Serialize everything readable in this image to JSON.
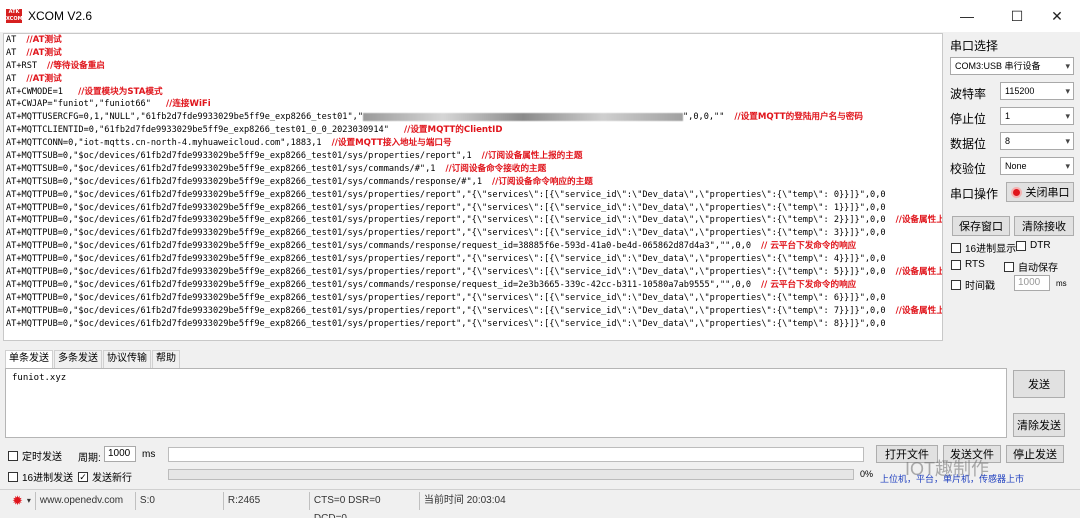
{
  "window": {
    "title": "XCOM V2.6",
    "icon_text": "ATK XCOM",
    "min_glyph": "—",
    "max_glyph": "☐",
    "close_glyph": "✕"
  },
  "receive_lines": [
    {
      "cmd": "AT",
      "comment": "//AT测试"
    },
    {
      "cmd": "AT",
      "comment": "//AT测试"
    },
    {
      "cmd": "AT+RST",
      "comment": "//等待设备重启"
    },
    {
      "cmd": "AT",
      "comment": "//AT测试"
    },
    {
      "cmd": "AT+CWMODE=1 ",
      "comment": "//设置模块为STA模式"
    },
    {
      "cmd": "AT+CWJAP=\"funiot\",\"funiot66\" ",
      "comment": "//连接WiFi"
    },
    {
      "cmd": "AT+MQTTUSERCFG=0,1,\"NULL\",\"61fb2d7fde9933029be5ff9e_exp8266_test01\",\"",
      "redacted": true,
      "cmd2": "\",0,0,\"\"",
      "comment": "//设置MQTT的登陆用户名与密码"
    },
    {
      "cmd": "AT+MQTTCLIENTID=0,\"61fb2d7fde9933029be5ff9e_exp8266_test01_0_0_2023030914\" ",
      "comment": "//设置MQTT的ClientID"
    },
    {
      "cmd": "AT+MQTTCONN=0,\"iot-mqtts.cn-north-4.myhuaweicloud.com\",1883,1",
      "comment": "//设置MQTT接入地址与端口号"
    },
    {
      "cmd": "AT+MQTTSUB=0,\"$oc/devices/61fb2d7fde9933029be5ff9e_exp8266_test01/sys/properties/report\",1",
      "comment": "//订阅设备属性上报的主题"
    },
    {
      "cmd": "AT+MQTTSUB=0,\"$oc/devices/61fb2d7fde9933029be5ff9e_exp8266_test01/sys/commands/#\",1",
      "comment": "//订阅设备命令接收的主题"
    },
    {
      "cmd": "AT+MQTTSUB=0,\"$oc/devices/61fb2d7fde9933029be5ff9e_exp8266_test01/sys/commands/response/#\",1",
      "comment": "//订阅设备命令响应的主题"
    },
    {
      "cmd": "AT+MQTTPUB=0,\"$oc/devices/61fb2d7fde9933029be5ff9e_exp8266_test01/sys/properties/report\",\"{\\\"services\\\":[{\\\"service_id\\\":\\\"Dev_data\\\",\\\"properties\\\":{\\\"temp\\\": 0}}]}\",0,0",
      "comment": ""
    },
    {
      "cmd": "AT+MQTTPUB=0,\"$oc/devices/61fb2d7fde9933029be5ff9e_exp8266_test01/sys/properties/report\",\"{\\\"services\\\":[{\\\"service_id\\\":\\\"Dev_data\\\",\\\"properties\\\":{\\\"temp\\\": 1}}]}\",0,0",
      "comment": ""
    },
    {
      "cmd": "AT+MQTTPUB=0,\"$oc/devices/61fb2d7fde9933029be5ff9e_exp8266_test01/sys/properties/report\",\"{\\\"services\\\":[{\\\"service_id\\\":\\\"Dev_data\\\",\\\"properties\\\":{\\\"temp\\\": 2}}]}\",0,0",
      "comment": "//设备属性上报"
    },
    {
      "cmd": "AT+MQTTPUB=0,\"$oc/devices/61fb2d7fde9933029be5ff9e_exp8266_test01/sys/properties/report\",\"{\\\"services\\\":[{\\\"service_id\\\":\\\"Dev_data\\\",\\\"properties\\\":{\\\"temp\\\": 3}}]}\",0,0",
      "comment": ""
    },
    {
      "cmd": "AT+MQTTPUB=0,\"$oc/devices/61fb2d7fde9933029be5ff9e_exp8266_test01/sys/commands/response/request_id=38885f6e-593d-41a0-be4d-065862d87d4a3\",\"\",0,0",
      "comment": "// 云平台下发命令的响应"
    },
    {
      "cmd": "AT+MQTTPUB=0,\"$oc/devices/61fb2d7fde9933029be5ff9e_exp8266_test01/sys/properties/report\",\"{\\\"services\\\":[{\\\"service_id\\\":\\\"Dev_data\\\",\\\"properties\\\":{\\\"temp\\\": 4}}]}\",0,0",
      "comment": ""
    },
    {
      "cmd": "AT+MQTTPUB=0,\"$oc/devices/61fb2d7fde9933029be5ff9e_exp8266_test01/sys/properties/report\",\"{\\\"services\\\":[{\\\"service_id\\\":\\\"Dev_data\\\",\\\"properties\\\":{\\\"temp\\\": 5}}]}\",0,0",
      "comment": "//设备属性上报"
    },
    {
      "cmd": "AT+MQTTPUB=0,\"$oc/devices/61fb2d7fde9933029be5ff9e_exp8266_test01/sys/commands/response/request_id=2e3b3665-339c-42cc-b311-10580a7ab9555\",\"\",0,0",
      "comment": "// 云平台下发命令的响应"
    },
    {
      "cmd": "AT+MQTTPUB=0,\"$oc/devices/61fb2d7fde9933029be5ff9e_exp8266_test01/sys/properties/report\",\"{\\\"services\\\":[{\\\"service_id\\\":\\\"Dev_data\\\",\\\"properties\\\":{\\\"temp\\\": 6}}]}\",0,0",
      "comment": ""
    },
    {
      "cmd": "AT+MQTTPUB=0,\"$oc/devices/61fb2d7fde9933029be5ff9e_exp8266_test01/sys/properties/report\",\"{\\\"services\\\":[{\\\"service_id\\\":\\\"Dev_data\\\",\\\"properties\\\":{\\\"temp\\\": 7}}]}\",0,0",
      "comment": "//设备属性上报"
    },
    {
      "cmd": "AT+MQTTPUB=0,\"$oc/devices/61fb2d7fde9933029be5ff9e_exp8266_test01/sys/properties/report\",\"{\\\"services\\\":[{\\\"service_id\\\":\\\"Dev_data\\\",\\\"properties\\\":{\\\"temp\\\": 8}}]}\",0,0",
      "comment": ""
    }
  ],
  "serial": {
    "section_title": "串口选择",
    "port": "COM3:USB 串行设备",
    "baud_label": "波特率",
    "baud": "115200",
    "stop_label": "停止位",
    "stop": "1",
    "data_label": "数据位",
    "data": "8",
    "parity_label": "校验位",
    "parity": "None",
    "op_label": "串口操作",
    "close_port": "关闭串口",
    "save_window": "保存窗口",
    "clear_receive": "清除接收",
    "hex_display": "16进制显示",
    "dtr": "DTR",
    "rts": "RTS",
    "auto_save": "自动保存",
    "timestamp": "时间戳",
    "timestamp_value": "1000",
    "ms": "ms"
  },
  "tabs": [
    "单条发送",
    "多条发送",
    "协议传输",
    "帮助"
  ],
  "send": {
    "text": "funiot.xyz",
    "send_button": "发送",
    "clear_send": "清除发送",
    "timed_send": "定时发送",
    "period_label": "周期:",
    "period_value": "1000",
    "ms": "ms",
    "open_file": "打开文件",
    "send_file": "发送文件",
    "stop_send": "停止发送",
    "hex_send": "16进制发送",
    "send_newline": "发送新行",
    "percent": "0%"
  },
  "status": {
    "url": "www.openedv.com",
    "s": "S:0",
    "r": "R:2465",
    "lines": "CTS=0 DSR=0 DCD=0",
    "time": "当前时间 20:03:04"
  },
  "watermark": {
    "main": "IOT趣制作",
    "sub": "上位机，平台，单片机，传感器上市"
  }
}
